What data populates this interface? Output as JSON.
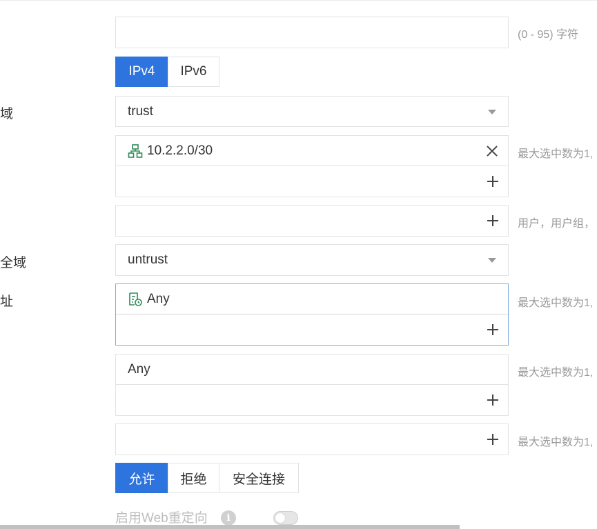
{
  "labels": {
    "source_zone": "域",
    "dest_zone": "全域",
    "dest_address": "址"
  },
  "name_field": {
    "value": "",
    "hint": "(0 - 95) 字符"
  },
  "ip_type": {
    "options": [
      "IPv4",
      "IPv6"
    ],
    "selected": "IPv4"
  },
  "source_zone": {
    "value": "trust"
  },
  "source_address": {
    "items": [
      {
        "icon": "network-icon",
        "text": "10.2.2.0/30"
      }
    ],
    "hint": "最大选中数为1,"
  },
  "user": {
    "hint": "用户，用户组，"
  },
  "dest_zone": {
    "value": "untrust"
  },
  "dest_address": {
    "items": [
      {
        "icon": "address-any-icon",
        "text": "Any"
      }
    ],
    "hint": "最大选中数为1,"
  },
  "service": {
    "value": "Any",
    "hint": "最大选中数为1,"
  },
  "application": {
    "hint": "最大选中数为1,"
  },
  "action": {
    "options": [
      "允许",
      "拒绝",
      "安全连接"
    ],
    "selected": "允许"
  },
  "web_redirect": {
    "label": "启用Web重定向",
    "enabled": false
  },
  "colors": {
    "accent": "#2e74de",
    "icon_green": "#2e8b57",
    "border": "#e3e3e3",
    "hint": "#9a9a9a"
  }
}
